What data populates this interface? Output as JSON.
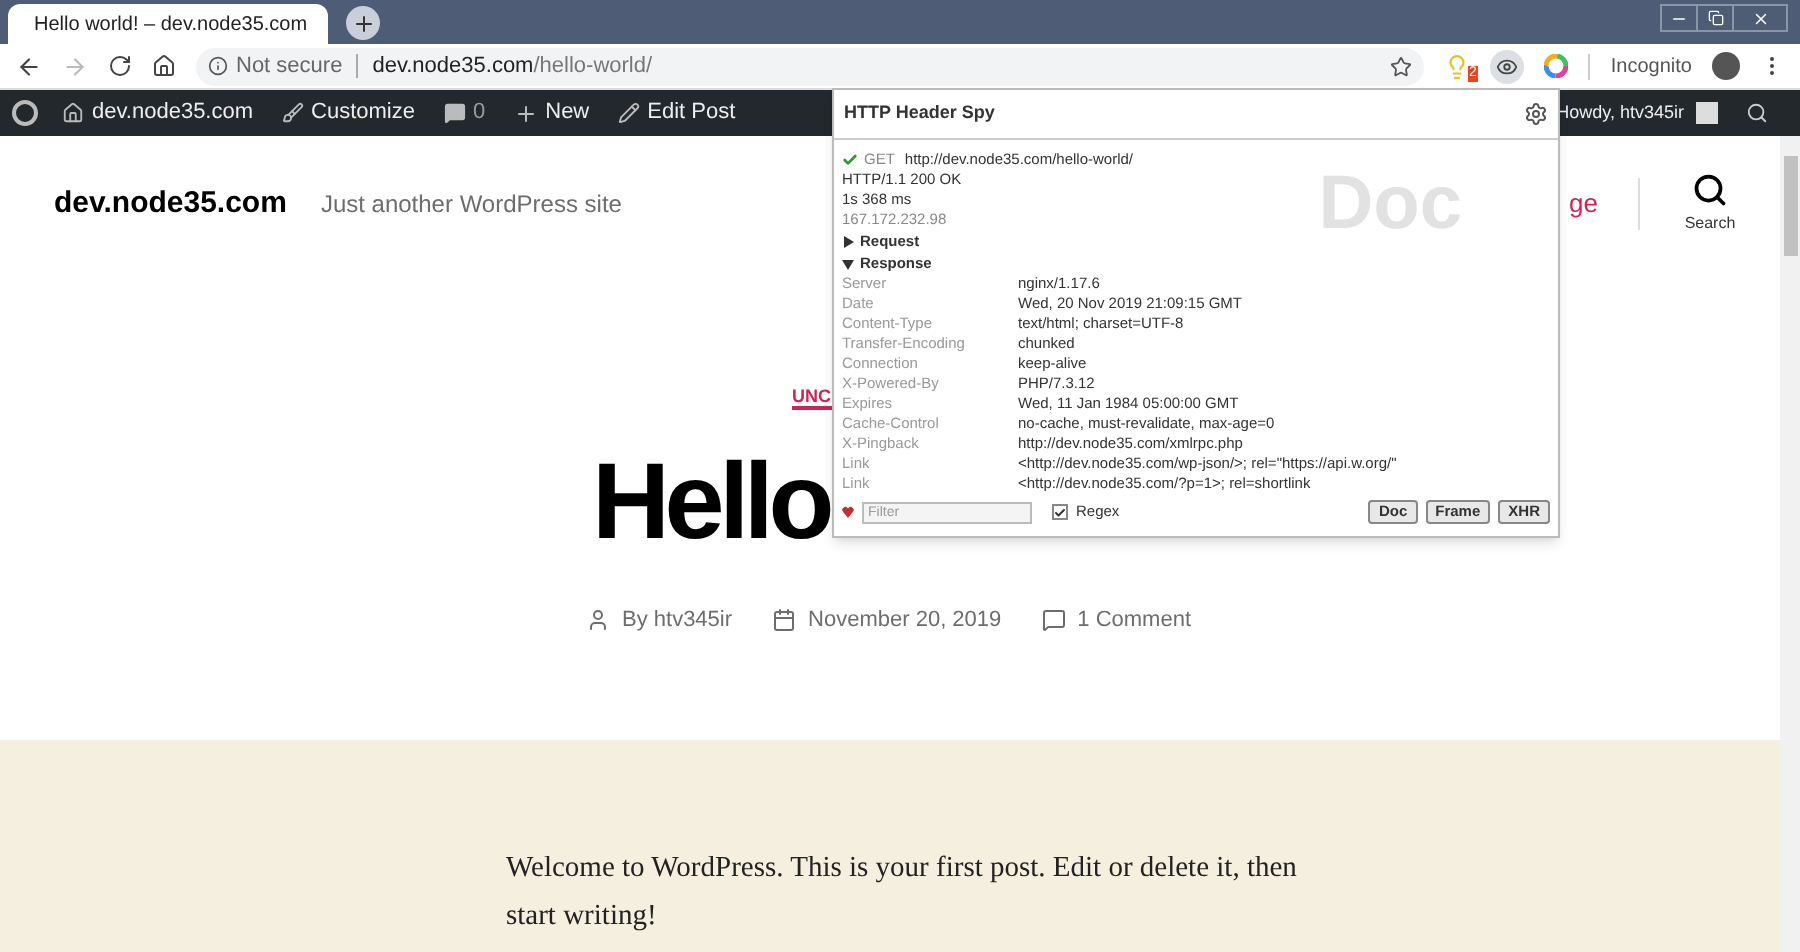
{
  "browser": {
    "tab": {
      "title": "Hello world! – dev.node35.com",
      "selected": true
    },
    "address": {
      "security": "Not secure",
      "host": "dev.node35.com",
      "path": "/hello-world/"
    },
    "extension_badge": "2",
    "profile": "Incognito"
  },
  "admin_bar": {
    "site": "dev.node35.com",
    "customize": "Customize",
    "comments": "0",
    "new": "New",
    "edit": "Edit Post",
    "howdy": "Howdy, htv345ir"
  },
  "site": {
    "title": "dev.node35.com",
    "tagline": "Just another WordPress site",
    "nav_fragment": "ge",
    "search": "Search"
  },
  "post": {
    "category": "UNC",
    "title": "Hello",
    "author": "By htv345ir",
    "date": "November 20, 2019",
    "comments": "1 Comment",
    "body": "Welcome to WordPress. This is your first post. Edit or delete it, then start writing!"
  },
  "popup": {
    "title": "HTTP Header Spy",
    "method": "GET",
    "url": "http://dev.node35.com/hello-world/",
    "status": "HTTP/1.1 200 OK",
    "time": "1s 368 ms",
    "ip": "167.172.232.98",
    "watermark": "Doc",
    "sections": [
      {
        "label": "Request",
        "expanded": false
      },
      {
        "label": "Response",
        "expanded": true
      }
    ],
    "headers": [
      {
        "name": "Server",
        "value": "nginx/1.17.6"
      },
      {
        "name": "Date",
        "value": "Wed, 20 Nov 2019 21:09:15 GMT"
      },
      {
        "name": "Content-Type",
        "value": "text/html; charset=UTF-8"
      },
      {
        "name": "Transfer-Encoding",
        "value": "chunked"
      },
      {
        "name": "Connection",
        "value": "keep-alive"
      },
      {
        "name": "X-Powered-By",
        "value": "PHP/7.3.12"
      },
      {
        "name": "Expires",
        "value": "Wed, 11 Jan 1984 05:00:00 GMT"
      },
      {
        "name": "Cache-Control",
        "value": "no-cache, must-revalidate, max-age=0"
      },
      {
        "name": "X-Pingback",
        "value": "http://dev.node35.com/xmlrpc.php"
      },
      {
        "name": "Link",
        "value": "<http://dev.node35.com/wp-json/>; rel=\"https://api.w.org/\""
      },
      {
        "name": "Link",
        "value": "<http://dev.node35.com/?p=1>; rel=shortlink"
      }
    ],
    "filter": {
      "placeholder": "Filter"
    },
    "regex": {
      "label": "Regex",
      "checked": true
    },
    "buttons": [
      "Doc",
      "Frame",
      "XHR"
    ]
  }
}
